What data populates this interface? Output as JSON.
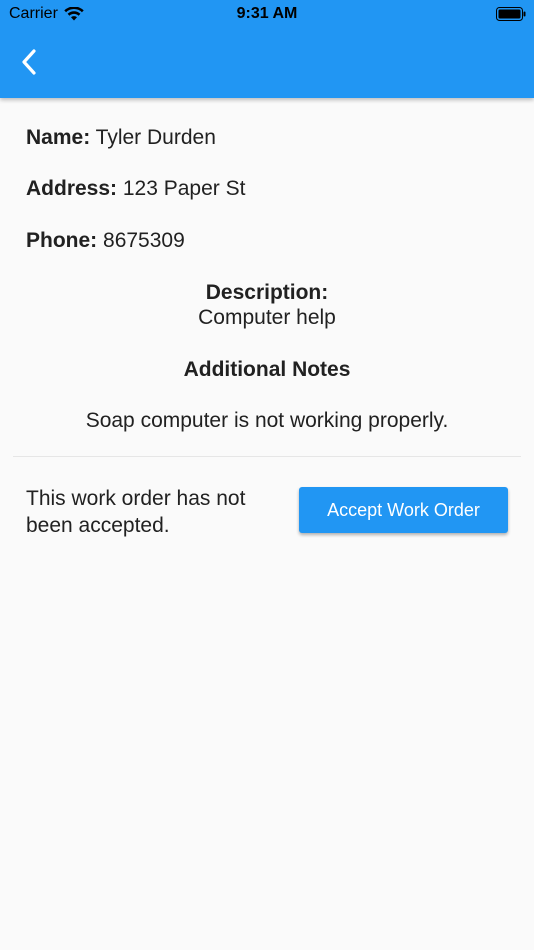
{
  "status_bar": {
    "carrier": "Carrier",
    "time": "9:31 AM",
    "wifi_icon": "wifi-icon",
    "battery_icon": "battery-icon"
  },
  "app_bar": {
    "color": "#2196f3",
    "back_icon": "chevron-left-icon"
  },
  "details": {
    "name_label": "Name:",
    "name_value": "Tyler Durden",
    "address_label": "Address:",
    "address_value": "123 Paper St",
    "phone_label": "Phone:",
    "phone_value": "8675309",
    "description_label": "Description:",
    "description_value": "Computer help",
    "notes_label": "Additional Notes",
    "notes_value": "Soap computer is not working properly."
  },
  "work_order": {
    "status_text": "This work order has not been accepted.",
    "accept_label": "Accept Work Order",
    "button_color": "#2196f3"
  }
}
